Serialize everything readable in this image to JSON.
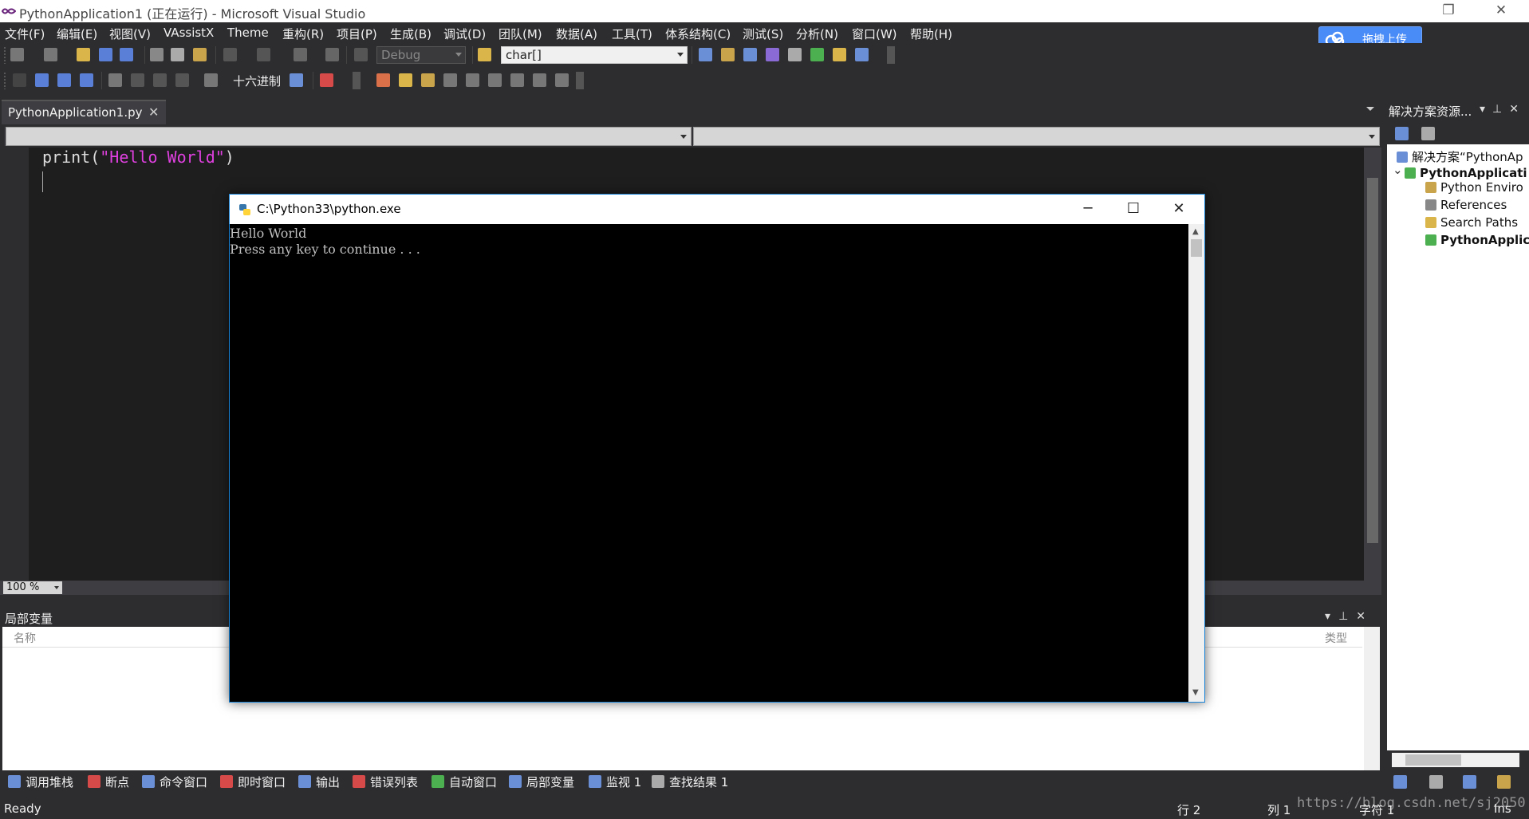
{
  "window": {
    "title": "PythonApplication1 (正在运行) - Microsoft Visual Studio"
  },
  "menu": [
    "文件(F)",
    "编辑(E)",
    "视图(V)",
    "VAssistX",
    "Theme",
    "重构(R)",
    "项目(P)",
    "生成(B)",
    "调试(D)",
    "团队(M)",
    "数据(A)",
    "工具(T)",
    "体系结构(C)",
    "测试(S)",
    "分析(N)",
    "窗口(W)",
    "帮助(H)"
  ],
  "upload_button": {
    "label": "拖拽上传"
  },
  "toolbar": {
    "config": "Debug",
    "find_combo": "char[]",
    "hex_label": "十六进制"
  },
  "editor": {
    "tab": "PythonApplication1.py",
    "code_fn": "print(",
    "code_str": "\"Hello World\"",
    "code_end": ")",
    "zoom": "100 %"
  },
  "locals_panel": {
    "title": "局部变量",
    "col_name": "名称",
    "col_type": "类型"
  },
  "bottom_tabs": [
    "调用堆栈",
    "断点",
    "命令窗口",
    "即时窗口",
    "输出",
    "错误列表",
    "自动窗口",
    "局部变量",
    "监视 1",
    "查找结果 1"
  ],
  "status": {
    "ready": "Ready",
    "line": "行 2",
    "col": "列 1",
    "char": "字符 1",
    "mode": "Ins"
  },
  "watermark": "https://blog.csdn.net/sj2050",
  "solution": {
    "header": "解决方案资源...",
    "items": [
      "解决方案“PythonAp",
      "PythonApplicati",
      "Python Enviro",
      "References",
      "Search Paths",
      "PythonApplic"
    ]
  },
  "console": {
    "title": "C:\\Python33\\python.exe",
    "lines": [
      "Hello World",
      "Press any key to continue . . ."
    ]
  }
}
